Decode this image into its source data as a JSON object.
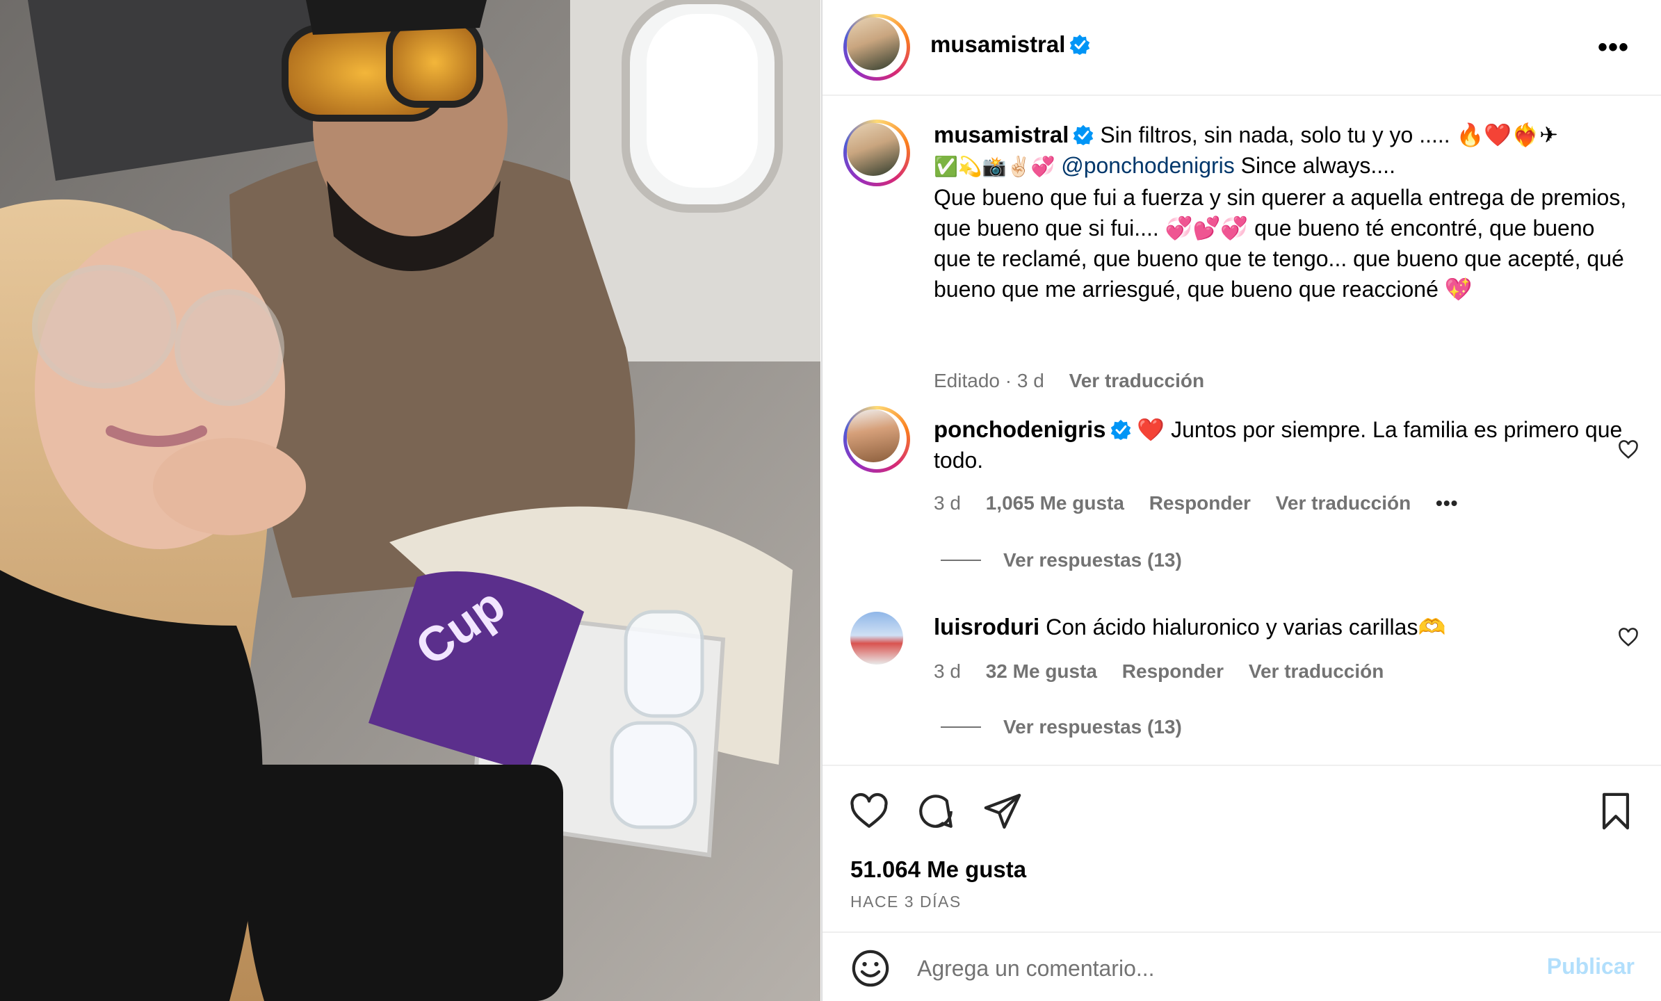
{
  "post": {
    "author": "musamistral",
    "caption_line1": "Sin filtros, sin nada, solo tu y yo ..... 🔥❤️❤️‍🔥✈",
    "caption_emojis": "✅💫📸✌🏻💞",
    "caption_mention": "@ponchodenigris",
    "caption_line2_rest": " Since always....",
    "caption_body": "Que bueno que fui a fuerza y sin querer a aquella entrega de premios, que bueno que si fui.... 💞💕💞 que bueno té encontré, que bueno que te reclamé, que bueno que te tengo... que bueno que acepté, qué bueno que me arriesgué, que bueno que reaccioné 💖",
    "caption_meta_edited": "Editado · 3 d",
    "caption_meta_translate": "Ver traducción",
    "likes": "51.064 Me gusta",
    "time_ago": "HACE 3 DÍAS"
  },
  "header": {
    "username": "musamistral",
    "more": "•••"
  },
  "comments": [
    {
      "username": "ponchodenigris",
      "text": "❤️ Juntos por siempre. La familia es primero que todo.",
      "age": "3 d",
      "likes": "1,065 Me gusta",
      "reply": "Responder",
      "translate": "Ver traducción",
      "more": "•••",
      "view_replies": "Ver respuestas (13)"
    },
    {
      "username": "luisroduri",
      "text": "Con ácido hialuronico y varias carillas🫶",
      "age": "3 d",
      "likes": "32 Me gusta",
      "reply": "Responder",
      "translate": "Ver traducción",
      "view_replies": "Ver respuestas (13)"
    }
  ],
  "add_comment": {
    "placeholder": "Agrega un comentario...",
    "publish": "Publicar"
  },
  "colors": {
    "verified": "#0095f6",
    "mention": "#00376b",
    "secondary_text": "#737373",
    "publish_disabled": "#b2dffc"
  },
  "icons": [
    "verified-badge-icon",
    "heart-icon",
    "comment-icon",
    "share-icon",
    "bookmark-icon",
    "emoji-icon",
    "more-icon"
  ]
}
